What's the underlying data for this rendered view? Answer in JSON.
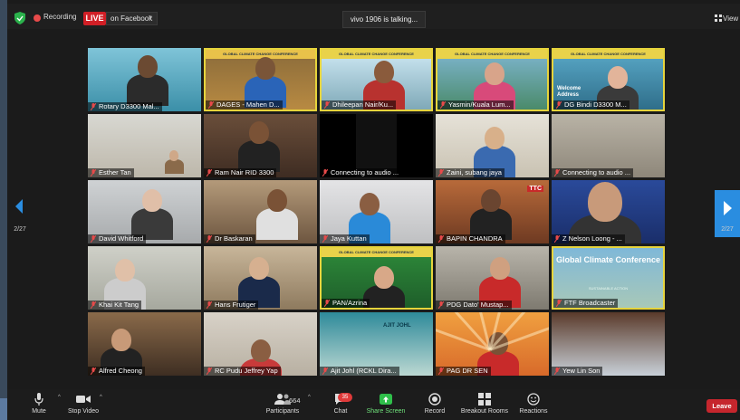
{
  "topbar": {
    "recording_label": "Recording",
    "live_label": "LIVE",
    "stream_target": "on Facebook",
    "talking": "vivo 1906 is talking...",
    "view_label": "View"
  },
  "participants": [
    {
      "name": "Rotary D3300 Mal...",
      "active": false
    },
    {
      "name": "DAGES - Mahen D...",
      "active": true
    },
    {
      "name": "Dhileepan Nair/Ku...",
      "active": true
    },
    {
      "name": "Yasmin/Kuala Lum...",
      "active": true
    },
    {
      "name": "DG Bindi D3300 M...",
      "active": true
    },
    {
      "name": "Esther Tan",
      "active": false
    },
    {
      "name": "Ram Nair RID 3300",
      "active": false
    },
    {
      "name": "Connecting to audio ...",
      "active": false
    },
    {
      "name": "Zaini, subang jaya",
      "active": false
    },
    {
      "name": "Connecting to audio ...",
      "active": false
    },
    {
      "name": "David Whitford",
      "active": false
    },
    {
      "name": "Dr Baskaran",
      "active": false
    },
    {
      "name": "Jaya Kuttan",
      "active": false
    },
    {
      "name": "BAPIN CHANDRA",
      "active": false
    },
    {
      "name": "Z Nelson Loong - ...",
      "active": false
    },
    {
      "name": "Khai Kit Tang",
      "active": false
    },
    {
      "name": "Hans Frutiger",
      "active": false
    },
    {
      "name": "PAN/Azrina",
      "active": true
    },
    {
      "name": "PDG Dato' Mustap...",
      "active": false
    },
    {
      "name": "FTF Broadcaster",
      "active": true
    },
    {
      "name": "Alfred Cheong",
      "active": false
    },
    {
      "name": "RC Pudu Jeffrey Yap",
      "active": false
    },
    {
      "name": "Ajit Johl (RCKL Dira...",
      "active": false
    },
    {
      "name": "PAG DR SEN",
      "active": false
    },
    {
      "name": "Yew Lin Son",
      "active": false
    }
  ],
  "tile_text": {
    "conference_banner": "GLOBAL CLIMATE CHANGE CONFERENCE",
    "welcome": "Welcome Address",
    "ftf_title": "Global Climate Conference",
    "ftf_sub": "SUSTAINABLE ACTION",
    "ajit_title": "AJIT JOHL",
    "ttc": "TTC"
  },
  "pagination": {
    "left_page": "2/27",
    "right_page": "2/27"
  },
  "toolbar": {
    "mute": "Mute",
    "stop_video": "Stop Video",
    "participants": "Participants",
    "participant_count": "664",
    "chat": "Chat",
    "chat_count": "35",
    "share_screen": "Share Screen",
    "record": "Record",
    "breakout_rooms": "Breakout Rooms",
    "reactions": "Reactions",
    "leave": "Leave"
  },
  "colors": {
    "active_border": "#e6d43c",
    "live": "#d11f26",
    "share_green": "#6fe07a",
    "nav_blue": "#2a8de0",
    "leave_red": "#c6262d"
  }
}
